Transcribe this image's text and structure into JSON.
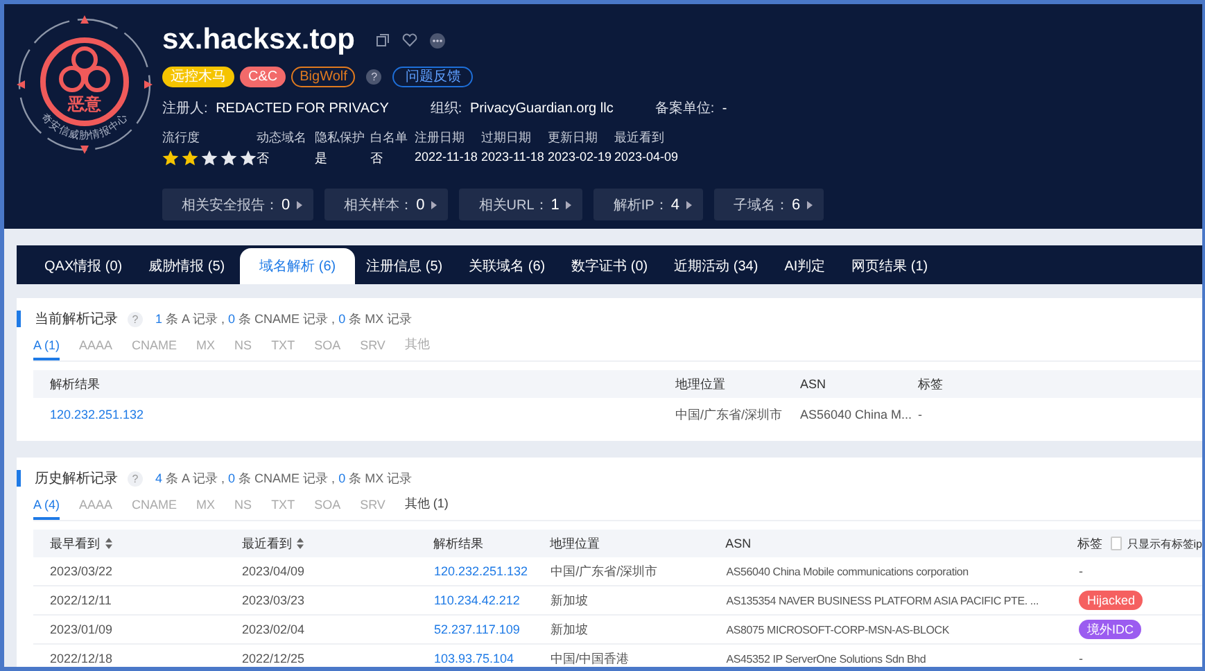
{
  "logo": {
    "label": "恶意",
    "caption": "奇安信威胁情报中心"
  },
  "domain": "sx.hacksx.top",
  "tags": [
    {
      "label": "远控木马",
      "kind": "filled",
      "color": "#f5c400"
    },
    {
      "label": "C&C",
      "kind": "filled",
      "color": "#f26a6a"
    },
    {
      "label": "BigWolf",
      "kind": "outline",
      "color": "#e07a1f"
    }
  ],
  "help_mark": "?",
  "feedback_button": "问题反馈",
  "registration": [
    {
      "label": "注册人:",
      "value": "REDACTED FOR PRIVACY"
    },
    {
      "label": "组织:",
      "value": "PrivacyGuardian.org llc"
    },
    {
      "label": "备案单位:",
      "value": "-"
    }
  ],
  "popularity": {
    "label": "流行度",
    "stars": 2
  },
  "facts": [
    {
      "label": "动态域名",
      "value": "否"
    },
    {
      "label": "隐私保护",
      "value": "是"
    },
    {
      "label": "白名单",
      "value": "否"
    },
    {
      "label": "注册日期",
      "value": "2022-11-18"
    },
    {
      "label": "过期日期",
      "value": "2023-11-18"
    },
    {
      "label": "更新日期",
      "value": "2023-02-19"
    },
    {
      "label": "最近看到",
      "value": "2023-04-09"
    }
  ],
  "related": [
    {
      "label": "相关安全报告：",
      "count": "0"
    },
    {
      "label": "相关样本：",
      "count": "0"
    },
    {
      "label": "相关URL：",
      "count": "1"
    },
    {
      "label": "解析IP：",
      "count": "4"
    },
    {
      "label": "子域名：",
      "count": "6"
    }
  ],
  "tabs": [
    {
      "label": "QAX情报 (0)",
      "selected": false
    },
    {
      "label": "威胁情报 (5)",
      "selected": false
    },
    {
      "label": "域名解析 (6)",
      "selected": true
    },
    {
      "label": "注册信息 (5)",
      "selected": false
    },
    {
      "label": "关联域名 (6)",
      "selected": false
    },
    {
      "label": "数字证书 (0)",
      "selected": false
    },
    {
      "label": "近期活动 (34)",
      "selected": false
    },
    {
      "label": "AI判定",
      "selected": false
    },
    {
      "label": "网页结果 (1)",
      "selected": false
    }
  ],
  "current": {
    "title": "当前解析记录",
    "help": "?",
    "summary": [
      {
        "count": "1",
        "text": " 条 A 记录 , "
      },
      {
        "count": "0",
        "text": " 条 CNAME 记录 , "
      },
      {
        "count": "0",
        "text": " 条 MX 记录"
      }
    ],
    "types": [
      {
        "label": "A (1)",
        "selected": true,
        "disabled": false
      },
      {
        "label": "AAAA",
        "selected": false,
        "disabled": true
      },
      {
        "label": "CNAME",
        "selected": false,
        "disabled": true
      },
      {
        "label": "MX",
        "selected": false,
        "disabled": true
      },
      {
        "label": "NS",
        "selected": false,
        "disabled": true
      },
      {
        "label": "TXT",
        "selected": false,
        "disabled": true
      },
      {
        "label": "SOA",
        "selected": false,
        "disabled": true
      },
      {
        "label": "SRV",
        "selected": false,
        "disabled": true
      },
      {
        "label": "其他",
        "selected": false,
        "disabled": true
      }
    ],
    "columns": [
      "解析结果",
      "地理位置",
      "ASN",
      "标签"
    ],
    "rows": [
      {
        "ip": "120.232.251.132",
        "location": "中国/广东省/深圳市",
        "asn": "AS56040 China M...",
        "tag": "-"
      }
    ]
  },
  "history": {
    "title": "历史解析记录",
    "help": "?",
    "summary": [
      {
        "count": "4",
        "text": " 条 A 记录 , "
      },
      {
        "count": "0",
        "text": " 条 CNAME 记录 , "
      },
      {
        "count": "0",
        "text": " 条 MX 记录"
      }
    ],
    "types": [
      {
        "label": "A (4)",
        "selected": true,
        "disabled": false
      },
      {
        "label": "AAAA",
        "selected": false,
        "disabled": true
      },
      {
        "label": "CNAME",
        "selected": false,
        "disabled": true
      },
      {
        "label": "MX",
        "selected": false,
        "disabled": true
      },
      {
        "label": "NS",
        "selected": false,
        "disabled": true
      },
      {
        "label": "TXT",
        "selected": false,
        "disabled": true
      },
      {
        "label": "SOA",
        "selected": false,
        "disabled": true
      },
      {
        "label": "SRV",
        "selected": false,
        "disabled": true
      },
      {
        "label": "其他 (1)",
        "selected": false,
        "disabled": false
      }
    ],
    "columns": [
      {
        "label": "最早看到",
        "sortable": true
      },
      {
        "label": "最近看到",
        "sortable": true
      },
      {
        "label": "解析结果",
        "sortable": false
      },
      {
        "label": "地理位置",
        "sortable": false
      },
      {
        "label": "ASN",
        "sortable": false
      },
      {
        "label": "标签",
        "sortable": false
      }
    ],
    "tag_filter": {
      "label": "只显示有标签ip",
      "checked": false
    },
    "rows": [
      {
        "first": "2023/03/22",
        "last": "2023/04/09",
        "ip": "120.232.251.132",
        "location": "中国/广东省/深圳市",
        "asn": "AS56040 China Mobile communications corporation",
        "tag": "-"
      },
      {
        "first": "2022/12/11",
        "last": "2023/03/23",
        "ip": "110.234.42.212",
        "location": "新加坡",
        "asn": "AS135354 NAVER BUSINESS PLATFORM ASIA PACIFIC PTE. ...",
        "tag": {
          "label": "Hijacked",
          "color": "#f56060"
        }
      },
      {
        "first": "2023/01/09",
        "last": "2023/02/04",
        "ip": "52.237.117.109",
        "location": "新加坡",
        "asn": "AS8075 MICROSOFT-CORP-MSN-AS-BLOCK",
        "tag": {
          "label": "境外IDC",
          "color": "#9b5cf0"
        }
      },
      {
        "first": "2022/12/18",
        "last": "2022/12/25",
        "ip": "103.93.75.104",
        "location": "中国/中国香港",
        "asn": "AS45352 IP ServerOne Solutions Sdn Bhd",
        "tag": "-"
      }
    ]
  }
}
